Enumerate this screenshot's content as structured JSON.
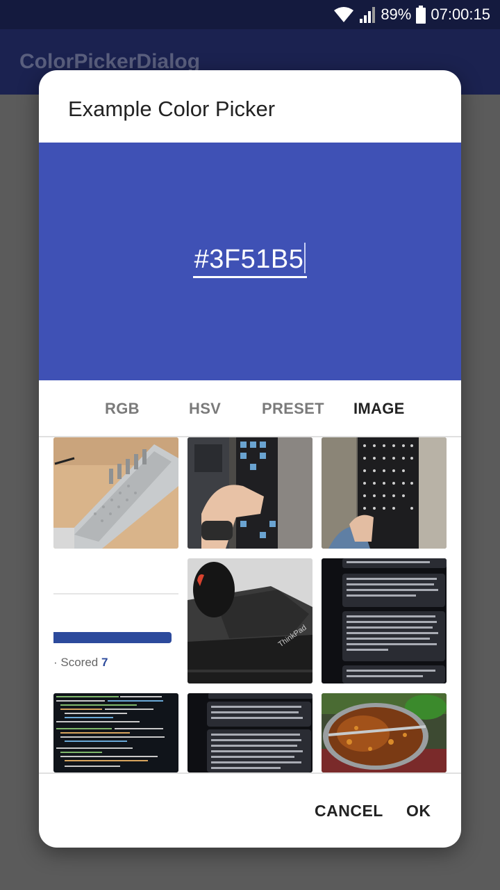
{
  "status_bar": {
    "battery_percent": "89%",
    "time": "07:00:15",
    "icons": [
      "wifi-icon",
      "signal-icon",
      "battery-icon"
    ]
  },
  "app_bar": {
    "title": "ColorPickerDialog"
  },
  "dialog": {
    "title": "Example Color Picker",
    "color_hex": "#3F51B5",
    "preview_color": "#3F51B5",
    "tabs": [
      {
        "label": "RGB",
        "active": false
      },
      {
        "label": "HSV",
        "active": false
      },
      {
        "label": "PRESET",
        "active": false
      },
      {
        "label": "IMAGE",
        "active": true
      }
    ],
    "images": [
      {
        "name": "image-keyboard-plate"
      },
      {
        "name": "image-keyboard-hand"
      },
      {
        "name": "image-keyboard-pcb"
      },
      {
        "name": "image-quiz-screenshot",
        "text_prefix": "· Scored ",
        "text_value": "7"
      },
      {
        "name": "image-mouse-laptop",
        "text": "ThinkPad"
      },
      {
        "name": "image-chat-screenshot-1"
      },
      {
        "name": "image-code-screenshot"
      },
      {
        "name": "image-chat-screenshot-2"
      },
      {
        "name": "image-hotpot"
      }
    ],
    "buttons": {
      "cancel": "CANCEL",
      "ok": "OK"
    }
  }
}
